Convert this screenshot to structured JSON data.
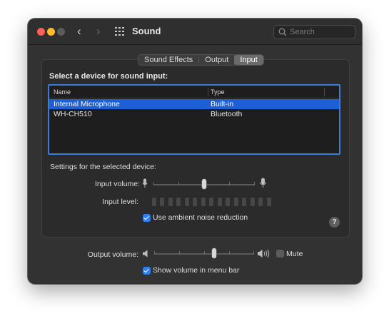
{
  "window": {
    "title": "Sound"
  },
  "search": {
    "placeholder": "Search"
  },
  "tabs": [
    {
      "label": "Sound Effects",
      "selected": false
    },
    {
      "label": "Output",
      "selected": false
    },
    {
      "label": "Input",
      "selected": true
    }
  ],
  "input": {
    "section_title": "Select a device for sound input:",
    "columns": [
      "Name",
      "Type"
    ],
    "devices": [
      {
        "name": "Internal Microphone",
        "type": "Built-in",
        "selected": true
      },
      {
        "name": "WH-CH510",
        "type": "Bluetooth",
        "selected": false
      }
    ],
    "settings_title": "Settings for the selected device:",
    "input_volume_label": "Input volume:",
    "input_volume_fraction": 0.5,
    "input_level_label": "Input level:",
    "input_level_segments": 15,
    "input_level_active": 0,
    "ambient_noise_label": "Use ambient noise reduction",
    "ambient_noise_checked": true,
    "help_label": "?"
  },
  "output": {
    "volume_label": "Output volume:",
    "volume_fraction": 0.6,
    "mute_label": "Mute",
    "mute_checked": false,
    "show_volume_label": "Show volume in menu bar",
    "show_volume_checked": true
  },
  "colors": {
    "accent": "#2f7ef6",
    "selection": "#1d5fd6"
  },
  "icons": [
    "back-arrow-icon",
    "forward-arrow-icon",
    "grid-icon",
    "search-icon",
    "microphone-icon",
    "speaker-icon",
    "help-icon"
  ]
}
